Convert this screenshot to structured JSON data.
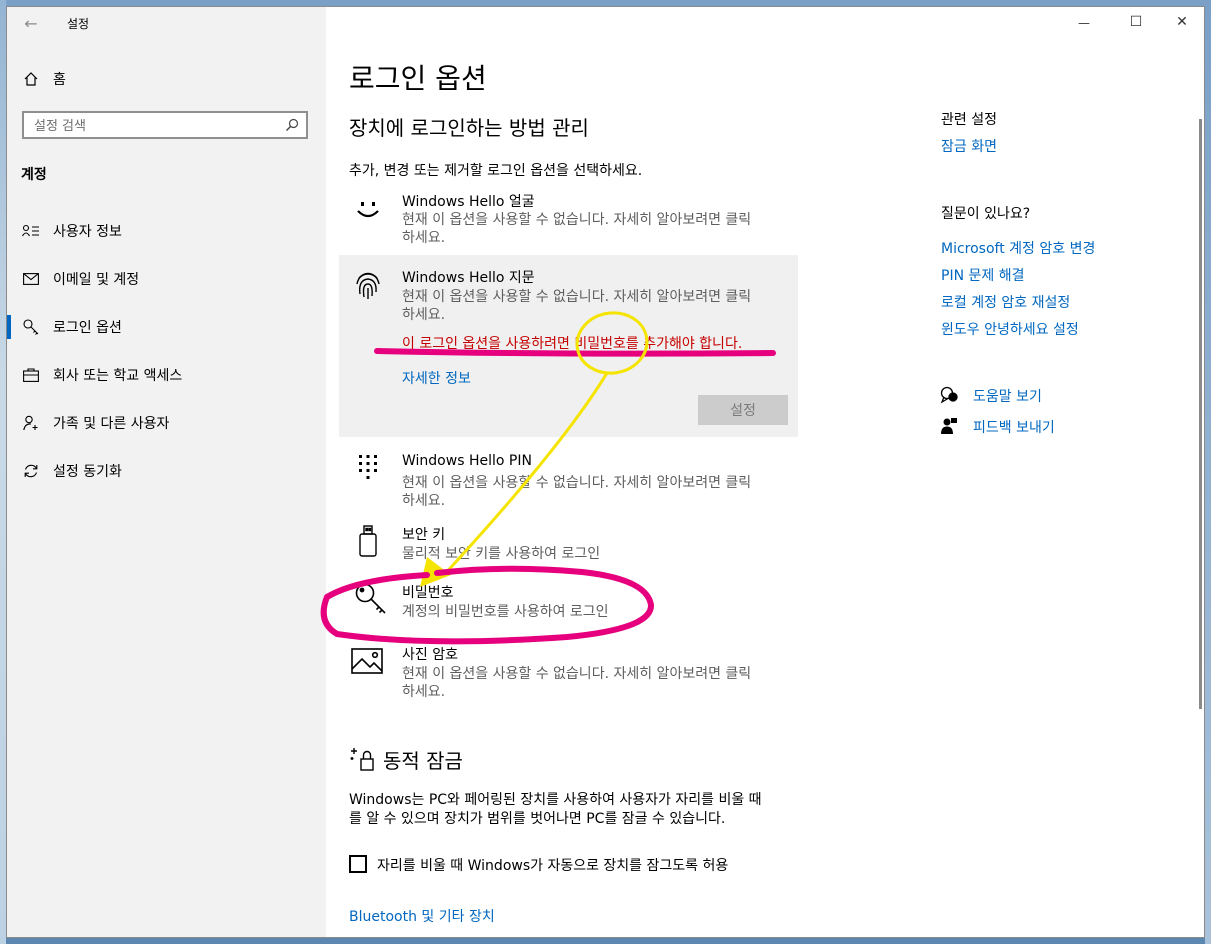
{
  "window": {
    "title": "설정",
    "minimize_glyph": "—",
    "maximize_glyph": "☐",
    "close_glyph": "✕"
  },
  "sidebar": {
    "home": "홈",
    "search_placeholder": "설정 검색",
    "section_title": "계정",
    "items": [
      {
        "label": "사용자 정보",
        "icon": "user-info-icon"
      },
      {
        "label": "이메일 및 계정",
        "icon": "mail-icon"
      },
      {
        "label": "로그인 옵션",
        "icon": "key-icon",
        "selected": true
      },
      {
        "label": "회사 또는 학교 액세스",
        "icon": "briefcase-icon"
      },
      {
        "label": "가족 및 다른 사용자",
        "icon": "person-add-icon"
      },
      {
        "label": "설정 동기화",
        "icon": "sync-icon"
      }
    ],
    "accent": "#0067c0"
  },
  "main": {
    "page_title": "로그인 옵션",
    "subtitle": "장치에 로그인하는 방법 관리",
    "instruction": "추가, 변경 또는 제거할 로그인 옵션을 선택하세요.",
    "options": [
      {
        "title": "Windows Hello 얼굴",
        "desc1": "현재 이 옵션을 사용할 수 없습니다. 자세히 알아보려면 클릭",
        "desc2": "하세요.",
        "icon": "face-icon"
      },
      {
        "title": "Windows Hello 지문",
        "desc1": "현재 이 옵션을 사용할 수 없습니다. 자세히 알아보려면 클릭",
        "desc2": "하세요.",
        "icon": "fingerprint-icon"
      },
      {
        "title": "Windows Hello PIN",
        "desc1": "현재 이 옵션을 사용할 수 없습니다. 자세히 알아보려면 클릭",
        "desc2": "하세요.",
        "icon": "pin-keypad-icon"
      },
      {
        "title": "보안 키",
        "desc1": "물리적 보안 키를 사용하여 로그인",
        "icon": "usb-key-icon"
      },
      {
        "title": "비밀번호",
        "desc1": "계정의 비밀번호를 사용하여 로그인",
        "icon": "password-key-icon"
      },
      {
        "title": "사진 암호",
        "desc1": "현재 이 옵션을 사용할 수 없습니다. 자세히 알아보려면 클릭",
        "desc2": "하세요.",
        "icon": "picture-icon"
      }
    ],
    "fingerprint_warning": "이 로그인 옵션을 사용하려면 비밀번호를 추가해야 합니다.",
    "fingerprint_more": "자세한 정보",
    "setup_button": "설정",
    "dynamic_lock": {
      "title": "동적 잠금",
      "desc1": "Windows는 PC와 페어링된 장치를 사용하여 사용자가 자리를 비울 때",
      "desc2": "를 알 수 있으며 장치가 범위를 벗어나면 PC를 잠글 수 있습니다.",
      "checkbox_label": "자리를 비울 때 Windows가 자동으로 장치를 잠그도록 허용",
      "bluetooth_link": "Bluetooth 및 기타 장치"
    },
    "warning_color": "#c50000"
  },
  "right": {
    "related_title": "관련 설정",
    "related_link": "잠금 화면",
    "help_title": "질문이 있나요?",
    "help_links": [
      "Microsoft 계정 암호 변경",
      "PIN 문제 해결",
      "로컬 계정 암호 재설정",
      "윈도우 안녕하세요 설정"
    ],
    "get_help": "도움말 보기",
    "feedback": "피드백 보내기"
  },
  "annotations": {
    "highlight_color": "#e6007e",
    "arrow_color": "#f5e400"
  }
}
